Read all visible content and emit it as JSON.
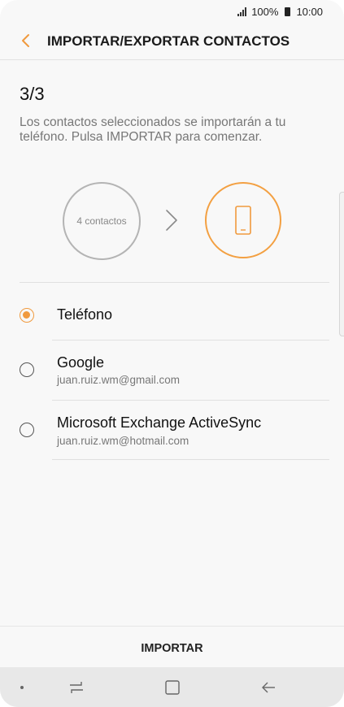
{
  "status": {
    "battery_pct": "100%",
    "time": "10:00"
  },
  "header": {
    "title": "IMPORTAR/EXPORTAR CONTACTOS",
    "back_icon": "chevron-left-icon"
  },
  "step": {
    "counter": "3/3",
    "description": "Los contactos seleccionados se importarán a tu teléfono. Pulsa IMPORTAR para comenzar."
  },
  "diagram": {
    "source_label": "4 contactos",
    "arrow_icon": "chevron-right-icon",
    "target_icon": "phone-icon"
  },
  "options": [
    {
      "label": "Teléfono",
      "sub": "",
      "selected": true
    },
    {
      "label": "Google",
      "sub": "juan.ruiz.wm@gmail.com",
      "selected": false
    },
    {
      "label": "Microsoft Exchange ActiveSync",
      "sub": "juan.ruiz.wm@hotmail.com",
      "selected": false
    }
  ],
  "footer": {
    "import_label": "IMPORTAR"
  },
  "colors": {
    "accent": "#f09a3e",
    "text": "#111111",
    "secondary": "#777777"
  }
}
